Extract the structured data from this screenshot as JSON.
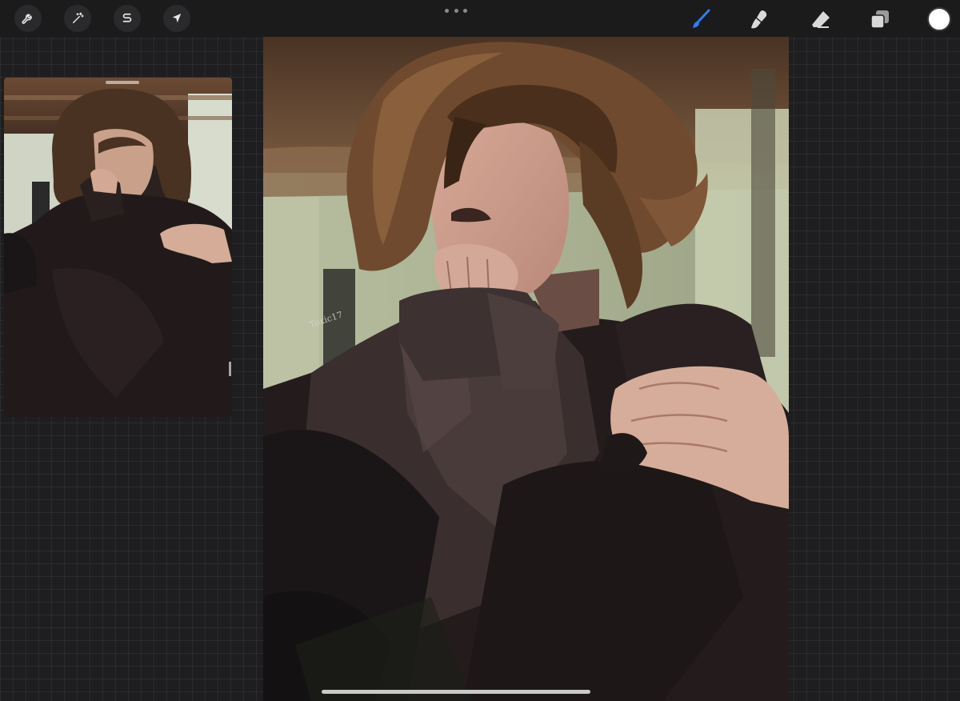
{
  "toolbar": {
    "left_tools": [
      {
        "name": "actions",
        "icon": "wrench-icon"
      },
      {
        "name": "adjustments",
        "icon": "magic-wand-icon"
      },
      {
        "name": "selection",
        "icon": "selection-s-icon"
      },
      {
        "name": "transform",
        "icon": "arrow-cursor-icon"
      }
    ],
    "right_tools": [
      {
        "name": "brush",
        "icon": "brush-icon",
        "active": true
      },
      {
        "name": "smudge",
        "icon": "smudge-icon",
        "active": false
      },
      {
        "name": "eraser",
        "icon": "eraser-icon",
        "active": false
      },
      {
        "name": "layers",
        "icon": "layers-icon",
        "active": false
      }
    ],
    "active_color": "#ffffff",
    "accent_color": "#2f7cf6"
  },
  "canvas": {
    "signature_text": "Toxic17"
  }
}
